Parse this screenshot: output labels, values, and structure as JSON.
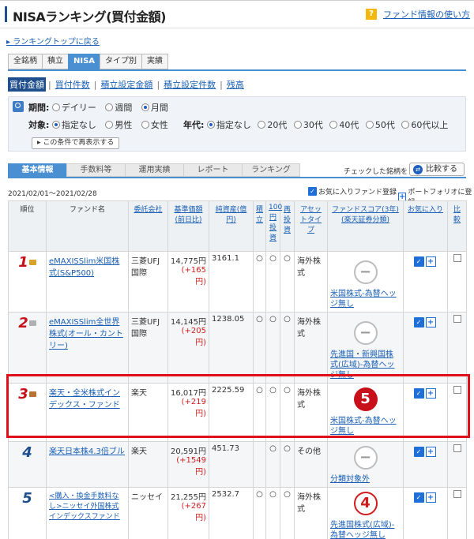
{
  "header": {
    "title": "NISAランキング(買付金額)",
    "help_icon": "?",
    "help_link": "ファンド情報の使い方"
  },
  "back_link": "ランキングトップに戻る",
  "category_tabs": [
    "全銘柄",
    "積立",
    "NISA",
    "タイプ別",
    "実績"
  ],
  "sort_options": [
    "買付金額",
    "買付件数",
    "積立設定金額",
    "積立設定件数",
    "残高"
  ],
  "filters": {
    "period_label": "期間:",
    "period_options": [
      "デイリー",
      "週間",
      "月間"
    ],
    "target_label": "対象:",
    "target_options": [
      "指定なし",
      "男性",
      "女性"
    ],
    "age_label": "年代:",
    "age_options": [
      "指定なし",
      "20代",
      "30代",
      "40代",
      "50代",
      "60代以上"
    ],
    "reshow_button": "この条件で再表示する"
  },
  "info_tabs": [
    "基本情報",
    "手数料等",
    "運用実績",
    "レポート",
    "ランキング"
  ],
  "compare_caption": "チェックした銘柄を",
  "compare_button": "比較する",
  "date_range": "2021/02/01〜2021/02/28",
  "legend": {
    "fav": "お気に入りファンド登録",
    "portfolio": "ポートフォリオに登録"
  },
  "table": {
    "headers": {
      "rank": "順位",
      "fund": "ファンド名",
      "company": "委託会社",
      "price": "基準価額(前日比)",
      "assets": "純資産(億円)",
      "tsumitate": "積立",
      "yen100": "100円投資",
      "reinvest": "再投資",
      "asset_type": "アセットタイプ",
      "score": "ファンドスコア(3年)(楽天証券分類)",
      "fav": "お気に入り",
      "compare": "比較"
    },
    "rows": [
      {
        "rank": "1",
        "fund": "eMAXISSlim米国株式(S&P500)",
        "company": "三菱UFJ国際",
        "price": "14,775円",
        "change": "(+165円)",
        "assets": "3161.1",
        "tsumitate": "○",
        "yen100": "○",
        "reinvest": "○",
        "asset_type": "海外株式",
        "score": "−",
        "score_label": "米国株式-為替ヘッジ無し"
      },
      {
        "rank": "2",
        "fund": "eMAXISSlim全世界株式(オール・カントリー)",
        "company": "三菱UFJ国際",
        "price": "14,145円",
        "change": "(+205円)",
        "assets": "1238.05",
        "tsumitate": "○",
        "yen100": "○",
        "reinvest": "○",
        "asset_type": "海外株式",
        "score": "−",
        "score_label": "先進国・新興国株式(広域)-為替ヘッジ無し"
      },
      {
        "rank": "3",
        "fund": "楽天・全米株式インデックス・ファンド",
        "company": "楽天",
        "price": "16,017円",
        "change": "(+219円)",
        "assets": "2225.59",
        "tsumitate": "○",
        "yen100": "○",
        "reinvest": "○",
        "asset_type": "海外株式",
        "score": "5",
        "score_label": "米国株式-為替ヘッジ無し"
      },
      {
        "rank": "4",
        "fund": "楽天日本株4.3倍ブル",
        "company": "楽天",
        "price": "20,591円",
        "change": "(+1549円)",
        "assets": "451.73",
        "tsumitate": "",
        "yen100": "○",
        "reinvest": "○",
        "asset_type": "その他",
        "score": "−",
        "score_label": "分類対象外"
      },
      {
        "rank": "5",
        "fund": "<購入・換金手数料なし>ニッセイ外国株式インデックスファンド",
        "company": "ニッセイ",
        "price": "21,255円",
        "change": "(+267円)",
        "assets": "2532.7",
        "tsumitate": "○",
        "yen100": "○",
        "reinvest": "○",
        "asset_type": "海外株式",
        "score": "4",
        "score_label": "先進国株式(広域)-為替ヘッジ無し"
      }
    ]
  },
  "colors": {
    "accent": "#4a8fd1",
    "navy": "#1f4e8c",
    "red": "#d01c1c",
    "highlight": "#e0101a"
  }
}
